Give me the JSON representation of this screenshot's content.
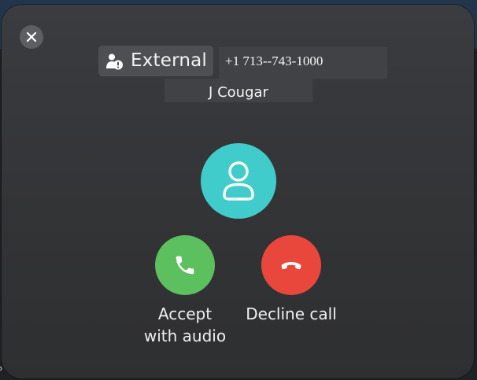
{
  "caller": {
    "external_label": "External",
    "phone_number": "+1 713--743-1000",
    "name": "J Cougar"
  },
  "actions": {
    "accept_label": "Accept\nwith audio",
    "decline_label": "Decline call"
  },
  "colors": {
    "accept": "#5dc05e",
    "decline": "#e9473c",
    "avatar": "#41cccc"
  },
  "icons": {
    "close": "close-icon",
    "external": "external-user-warning-icon",
    "avatar": "person-icon",
    "accept": "phone-icon",
    "decline": "hang-up-icon"
  }
}
